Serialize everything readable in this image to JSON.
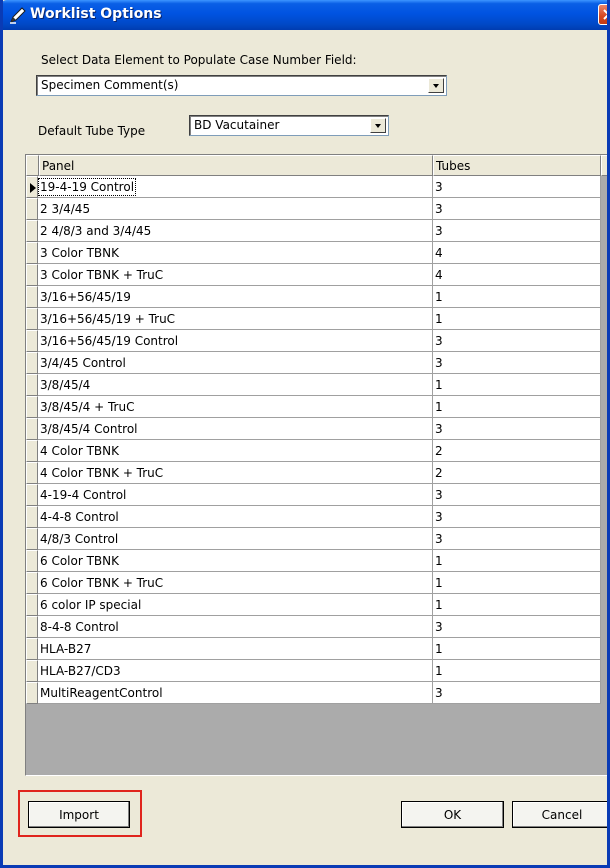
{
  "window": {
    "title": "Worklist Options"
  },
  "case_number": {
    "label": "Select Data Element to Populate Case Number Field:",
    "selected": "Specimen Comment(s)"
  },
  "tube_type": {
    "label": "Default Tube Type",
    "selected": "BD Vacutainer"
  },
  "grid": {
    "columns": [
      "Panel",
      "Tubes"
    ],
    "rows": [
      {
        "panel": "19-4-19 Control",
        "tubes": "3"
      },
      {
        "panel": "2 3/4/45",
        "tubes": "3"
      },
      {
        "panel": "2 4/8/3 and 3/4/45",
        "tubes": "3"
      },
      {
        "panel": "3 Color TBNK",
        "tubes": "4"
      },
      {
        "panel": "3 Color TBNK + TruC",
        "tubes": "4"
      },
      {
        "panel": "3/16+56/45/19",
        "tubes": "1"
      },
      {
        "panel": "3/16+56/45/19 + TruC",
        "tubes": "1"
      },
      {
        "panel": "3/16+56/45/19 Control",
        "tubes": "3"
      },
      {
        "panel": "3/4/45 Control",
        "tubes": "3"
      },
      {
        "panel": "3/8/45/4",
        "tubes": "1"
      },
      {
        "panel": "3/8/45/4 + TruC",
        "tubes": "1"
      },
      {
        "panel": "3/8/45/4 Control",
        "tubes": "3"
      },
      {
        "panel": "4 Color TBNK",
        "tubes": "2"
      },
      {
        "panel": "4 Color TBNK + TruC",
        "tubes": "2"
      },
      {
        "panel": "4-19-4 Control",
        "tubes": "3"
      },
      {
        "panel": "4-4-8 Control",
        "tubes": "3"
      },
      {
        "panel": "4/8/3 Control",
        "tubes": "3"
      },
      {
        "panel": "6 Color TBNK",
        "tubes": "1"
      },
      {
        "panel": "6 Color TBNK + TruC",
        "tubes": "1"
      },
      {
        "panel": "6 color IP special",
        "tubes": "1"
      },
      {
        "panel": "8-4-8 Control",
        "tubes": "3"
      },
      {
        "panel": "HLA-B27",
        "tubes": "1"
      },
      {
        "panel": "HLA-B27/CD3",
        "tubes": "1"
      },
      {
        "panel": "MultiReagentControl",
        "tubes": "3"
      }
    ]
  },
  "buttons": {
    "import": "Import",
    "ok": "OK",
    "cancel": "Cancel"
  },
  "colors": {
    "titlebar": "#0053e1",
    "dialog_bg": "#ece9d8",
    "grid_bg": "#ababab",
    "highlight": "#e0241d"
  }
}
